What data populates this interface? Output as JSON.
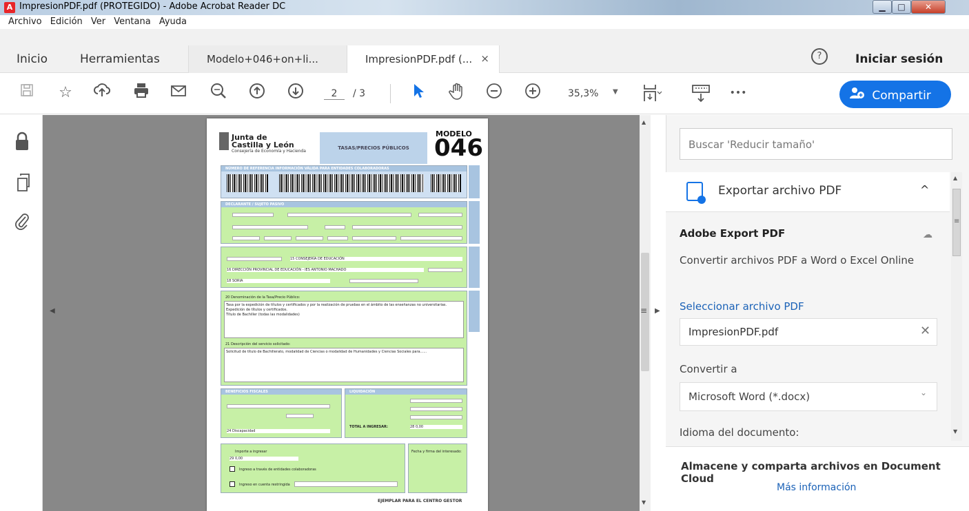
{
  "window": {
    "title": "ImpresionPDF.pdf (PROTEGIDO) - Adobe Acrobat Reader DC",
    "app_icon": "acrobat-icon",
    "controls": {
      "minimize": "▁",
      "maximize": "□",
      "close": "✕"
    }
  },
  "menu": [
    "Archivo",
    "Edición",
    "Ver",
    "Ventana",
    "Ayuda"
  ],
  "tabs": {
    "home": "Inicio",
    "tools": "Herramientas",
    "doc1": "Modelo+046+on+li...",
    "doc2": "ImpresionPDF.pdf (...",
    "doc2_close": "×",
    "help": "?",
    "signin": "Iniciar sesión"
  },
  "toolbar": {
    "page_current": "2",
    "page_total": "/ 3",
    "zoom": "35,3%",
    "zoom_arrow": "▼",
    "more": "•••",
    "share_label": "Compartir"
  },
  "document": {
    "header_line1": "Junta de",
    "header_line2": "Castilla y León",
    "header_line3": "Consejería de Economía y Hacienda",
    "tasas": "TASAS/PRECIOS PÚBLICOS",
    "modelo": "MODELO",
    "modelo_num": "046",
    "footer": "EJEMPLAR PARA EL CENTRO GESTOR",
    "s_ref": "NÚMERO DE REFERENCIA     INFORMACIÓN VÁLIDA PARA ENTIDADES COLABORADORAS",
    "s_decl": "DECLARANTE / SUJETO PASIVO",
    "s_fiscal": "BENEFICIOS FISCALES",
    "s_liq": "LIQUIDACIÓN",
    "organo": "15 CONSEJERÍA DE EDUCACIÓN",
    "direccion": "16 DIRECCIÓN PROVINCIAL DE EDUCACIÓN - IES ANTONIO MACHADO",
    "provincia": "18 SORIA",
    "denominacion": "20 Denominación de la Tasa/Precio Público:",
    "tasa_txt": "Tasa por la expedición de títulos y certificados y por la realización de pruebas en el ámbito de las enseñanzas no universitarias.",
    "tasa_txt2": "Expedición de títulos y certificados.",
    "tasa_txt3": "Título de Bachiller (todas las modalidades)",
    "descripcion": "21 Descripción del servicio solicitado:",
    "desc_txt": "Solicitud de título de Bachillerato, modalidad de Ciencias o modalidad de Humanidades y Ciencias Sociales para......",
    "importe": "Importe a ingresar",
    "importe_val": "29  0,00",
    "ingreso1": "Ingreso a través de entidades colaboradoras",
    "ingreso2": "Ingreso en cuenta restringida",
    "fecha_firma": "Fecha y firma del interesado:",
    "total": "TOTAL A INGRESAR:",
    "total_val": "28 0,00",
    "discapacidad": "24 Discapacidad"
  },
  "panel": {
    "search_placeholder": "Buscar 'Reducir tamaño'",
    "export_title": "Exportar archivo PDF",
    "export_chevron": "^",
    "aep_title": "Adobe Export PDF",
    "aep_desc": "Convertir archivos PDF a Word o Excel Online",
    "select_link": "Seleccionar archivo PDF",
    "file_name": "ImpresionPDF.pdf",
    "file_clear": "✕",
    "convert_label": "Convertir a",
    "convert_value": "Microsoft Word (*.docx)",
    "convert_arrow": "⌄",
    "lang_label": "Idioma del documento:",
    "store_text": "Almacene y comparta archivos en Document Cloud",
    "more_link": "Más información"
  },
  "colors": {
    "accent": "#1473e6",
    "form_green": "#c7f0a6",
    "form_blue": "#bcd3ea",
    "doc_bg": "#888888"
  }
}
